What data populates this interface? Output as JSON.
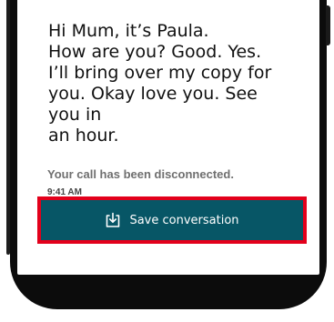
{
  "message": {
    "text": "Hi Mum, it’s Paula.\nHow are you? Good. Yes.\nI’ll bring over my copy for\nyou. Okay love you. See you in\nan hour."
  },
  "call": {
    "status": "Your call has been disconnected.",
    "time": "9:41 AM"
  },
  "actions": {
    "save_label": "Save conversation",
    "save_icon": "download-to-tray-icon"
  },
  "colors": {
    "button_bg": "#075666",
    "highlight": "#e3001b",
    "status_text": "#6f6f6f"
  }
}
